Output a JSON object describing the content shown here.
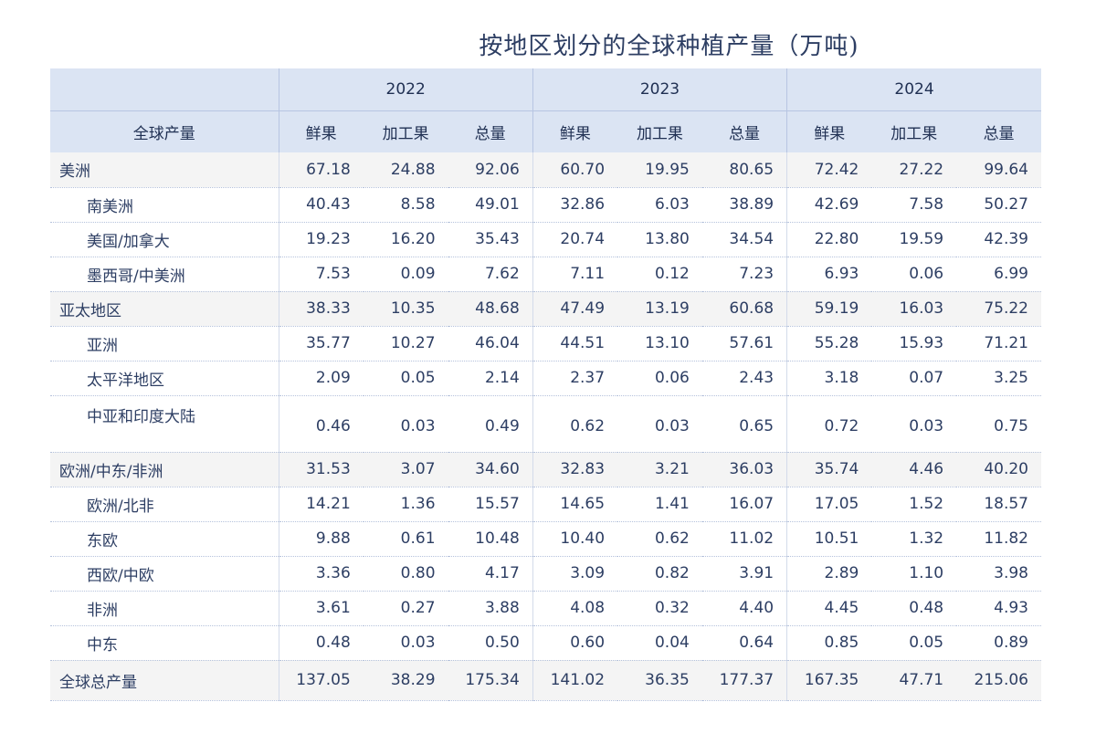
{
  "chart_data": {
    "type": "table",
    "title": "按地区划分的全球种植产量（万吨)",
    "row_header_label": "全球产量",
    "years": [
      "2022",
      "2023",
      "2024"
    ],
    "sub_columns": [
      "鲜果",
      "加工果",
      "总量"
    ],
    "rows": [
      {
        "name": "美洲",
        "level": "group",
        "values": [
          "67.18",
          "24.88",
          "92.06",
          "60.70",
          "19.95",
          "80.65",
          "72.42",
          "27.22",
          "99.64"
        ]
      },
      {
        "name": "南美洲",
        "level": "sub",
        "values": [
          "40.43",
          "8.58",
          "49.01",
          "32.86",
          "6.03",
          "38.89",
          "42.69",
          "7.58",
          "50.27"
        ]
      },
      {
        "name": "美国/加拿大",
        "level": "sub",
        "values": [
          "19.23",
          "16.20",
          "35.43",
          "20.74",
          "13.80",
          "34.54",
          "22.80",
          "19.59",
          "42.39"
        ]
      },
      {
        "name": "墨西哥/中美洲",
        "level": "sub",
        "values": [
          "7.53",
          "0.09",
          "7.62",
          "7.11",
          "0.12",
          "7.23",
          "6.93",
          "0.06",
          "6.99"
        ]
      },
      {
        "name": "亚太地区",
        "level": "group",
        "values": [
          "38.33",
          "10.35",
          "48.68",
          "47.49",
          "13.19",
          "60.68",
          "59.19",
          "16.03",
          "75.22"
        ]
      },
      {
        "name": "亚洲",
        "level": "sub",
        "values": [
          "35.77",
          "10.27",
          "46.04",
          "44.51",
          "13.10",
          "57.61",
          "55.28",
          "15.93",
          "71.21"
        ]
      },
      {
        "name": "太平洋地区",
        "level": "sub",
        "values": [
          "2.09",
          "0.05",
          "2.14",
          "2.37",
          "0.06",
          "2.43",
          "3.18",
          "0.07",
          "3.25"
        ]
      },
      {
        "name": "中亚和印度大陆",
        "level": "sub",
        "tall": true,
        "values": [
          "0.46",
          "0.03",
          "0.49",
          "0.62",
          "0.03",
          "0.65",
          "0.72",
          "0.03",
          "0.75"
        ]
      },
      {
        "name": "欧洲/中东/非洲",
        "level": "group",
        "values": [
          "31.53",
          "3.07",
          "34.60",
          "32.83",
          "3.21",
          "36.03",
          "35.74",
          "4.46",
          "40.20"
        ]
      },
      {
        "name": "欧洲/北非",
        "level": "sub",
        "values": [
          "14.21",
          "1.36",
          "15.57",
          "14.65",
          "1.41",
          "16.07",
          "17.05",
          "1.52",
          "18.57"
        ]
      },
      {
        "name": "东欧",
        "level": "sub",
        "values": [
          "9.88",
          "0.61",
          "10.48",
          "10.40",
          "0.62",
          "11.02",
          "10.51",
          "1.32",
          "11.82"
        ]
      },
      {
        "name": "西欧/中欧",
        "level": "sub",
        "values": [
          "3.36",
          "0.80",
          "4.17",
          "3.09",
          "0.82",
          "3.91",
          "2.89",
          "1.10",
          "3.98"
        ]
      },
      {
        "name": "非洲",
        "level": "sub",
        "values": [
          "3.61",
          "0.27",
          "3.88",
          "4.08",
          "0.32",
          "4.40",
          "4.45",
          "0.48",
          "4.93"
        ]
      },
      {
        "name": "中东",
        "level": "sub",
        "values": [
          "0.48",
          "0.03",
          "0.50",
          "0.60",
          "0.04",
          "0.64",
          "0.85",
          "0.05",
          "0.89"
        ]
      },
      {
        "name": "全球总产量",
        "level": "total",
        "values": [
          "137.05",
          "38.29",
          "175.34",
          "141.02",
          "36.35",
          "177.37",
          "167.35",
          "47.71",
          "215.06"
        ]
      }
    ]
  },
  "colors": {
    "header_bg": "#dbe4f3",
    "group_row_bg": "#f4f4f4",
    "text": "#2d3e63"
  }
}
